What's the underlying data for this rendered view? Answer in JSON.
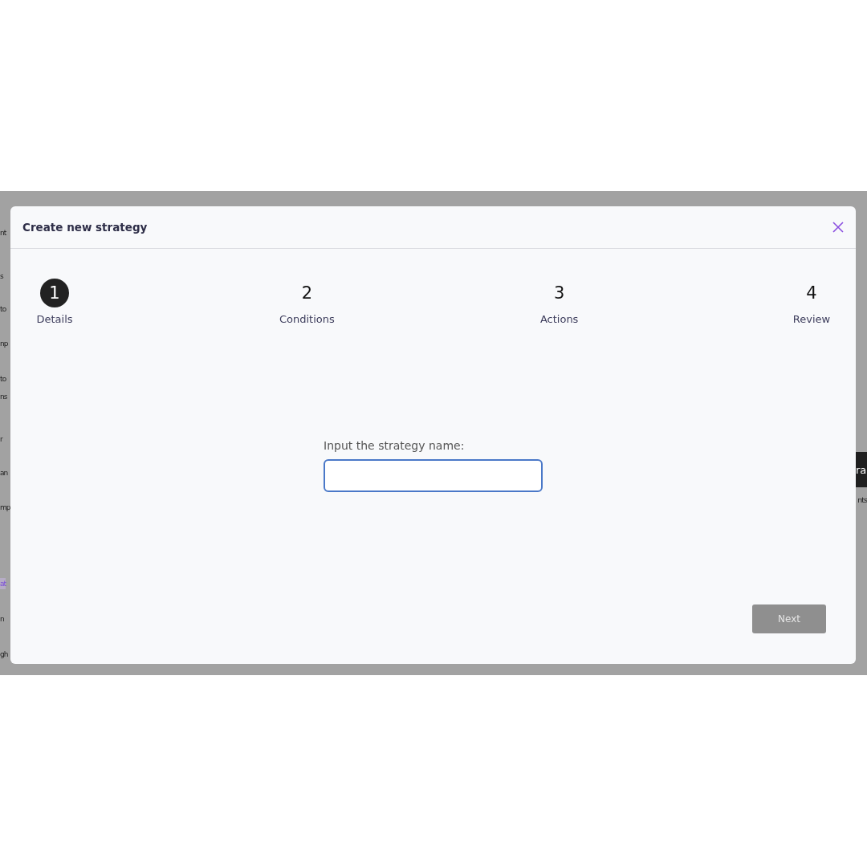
{
  "background": {
    "left_items": [
      {
        "text": "nt",
        "selected": false
      },
      {
        "text": "s",
        "selected": false
      },
      {
        "text": "to",
        "selected": false
      },
      {
        "text": "np",
        "selected": false
      },
      {
        "text": "to",
        "selected": false
      },
      {
        "text": "ns",
        "selected": false
      },
      {
        "text": "r",
        "selected": false
      },
      {
        "text": "an",
        "selected": false
      },
      {
        "text": "mp",
        "selected": false
      },
      {
        "text": "at",
        "selected": true
      },
      {
        "text": "n",
        "selected": false
      },
      {
        "text": "gh",
        "selected": false
      }
    ],
    "right_button": "ra",
    "right_text": "nts"
  },
  "dialog": {
    "title": "Create new strategy",
    "steps": [
      {
        "number": "1",
        "label": "Details",
        "selected": true
      },
      {
        "number": "2",
        "label": "Conditions",
        "selected": false
      },
      {
        "number": "3",
        "label": "Actions",
        "selected": false
      },
      {
        "number": "4",
        "label": "Review",
        "selected": false
      }
    ],
    "field": {
      "label": "Input the strategy name:",
      "focused": true
    },
    "next_button": {
      "label": "Next",
      "disabled": true
    }
  }
}
